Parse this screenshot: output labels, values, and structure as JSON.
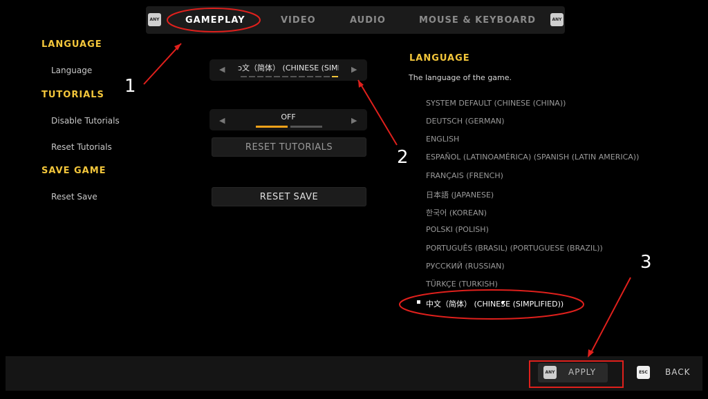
{
  "tabs": {
    "left_key": "ANY",
    "right_key": "ANY",
    "items": [
      "GAMEPLAY",
      "VIDEO",
      "AUDIO",
      "MOUSE & KEYBOARD"
    ]
  },
  "sections": {
    "language": {
      "title": "LANGUAGE",
      "items": [
        "Language"
      ]
    },
    "tutorials": {
      "title": "TUTORIALS",
      "items": [
        "Disable Tutorials",
        "Reset Tutorials"
      ]
    },
    "save_game": {
      "title": "SAVE GAME",
      "items": [
        "Reset Save"
      ]
    }
  },
  "controls": {
    "language_value": "ɔ文（简体） (CHINESE (SIMP",
    "tutorials_value": "OFF",
    "reset_tutorials_label": "RESET TUTORIALS",
    "reset_save_label": "RESET SAVE"
  },
  "details": {
    "title": "LANGUAGE",
    "description": "The language of the game.",
    "options": [
      "SYSTEM DEFAULT (CHINESE (CHINA))",
      "DEUTSCH (GERMAN)",
      "ENGLISH",
      "ESPAÑOL (LATINOAMÉRICA) (SPANISH (LATIN AMERICA))",
      "FRANÇAIS (FRENCH)",
      "日本語 (JAPANESE)",
      "한국어 (KOREAN)",
      "POLSKI (POLISH)",
      "PORTUGUÊS (BRASIL) (PORTUGUESE (BRAZIL))",
      "РУССКИЙ (RUSSIAN)",
      "TÜRKÇE (TURKISH)",
      "中文（简体） (CHINESE (SIMPLIFIED))"
    ],
    "selected_index": 11
  },
  "footer": {
    "apply_key": "ANY",
    "apply_label": "APPLY",
    "back_key": "ESC",
    "back_label": "BACK"
  },
  "annotations": [
    "1",
    "2",
    "3"
  ],
  "colors": {
    "accent": "#f3c63b",
    "annotation_red": "#e0201c"
  }
}
